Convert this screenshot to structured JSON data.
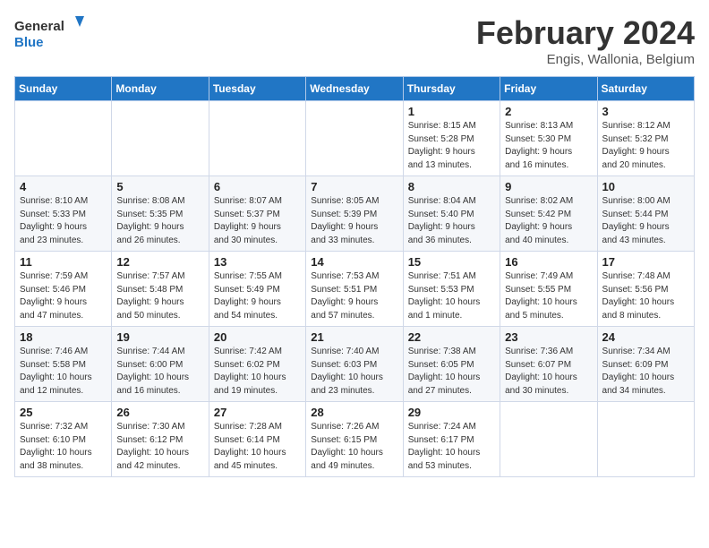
{
  "header": {
    "logo_line1": "General",
    "logo_line2": "Blue",
    "title": "February 2024",
    "location": "Engis, Wallonia, Belgium"
  },
  "weekdays": [
    "Sunday",
    "Monday",
    "Tuesday",
    "Wednesday",
    "Thursday",
    "Friday",
    "Saturday"
  ],
  "weeks": [
    [
      {
        "day": "",
        "info": ""
      },
      {
        "day": "",
        "info": ""
      },
      {
        "day": "",
        "info": ""
      },
      {
        "day": "",
        "info": ""
      },
      {
        "day": "1",
        "info": "Sunrise: 8:15 AM\nSunset: 5:28 PM\nDaylight: 9 hours\nand 13 minutes."
      },
      {
        "day": "2",
        "info": "Sunrise: 8:13 AM\nSunset: 5:30 PM\nDaylight: 9 hours\nand 16 minutes."
      },
      {
        "day": "3",
        "info": "Sunrise: 8:12 AM\nSunset: 5:32 PM\nDaylight: 9 hours\nand 20 minutes."
      }
    ],
    [
      {
        "day": "4",
        "info": "Sunrise: 8:10 AM\nSunset: 5:33 PM\nDaylight: 9 hours\nand 23 minutes."
      },
      {
        "day": "5",
        "info": "Sunrise: 8:08 AM\nSunset: 5:35 PM\nDaylight: 9 hours\nand 26 minutes."
      },
      {
        "day": "6",
        "info": "Sunrise: 8:07 AM\nSunset: 5:37 PM\nDaylight: 9 hours\nand 30 minutes."
      },
      {
        "day": "7",
        "info": "Sunrise: 8:05 AM\nSunset: 5:39 PM\nDaylight: 9 hours\nand 33 minutes."
      },
      {
        "day": "8",
        "info": "Sunrise: 8:04 AM\nSunset: 5:40 PM\nDaylight: 9 hours\nand 36 minutes."
      },
      {
        "day": "9",
        "info": "Sunrise: 8:02 AM\nSunset: 5:42 PM\nDaylight: 9 hours\nand 40 minutes."
      },
      {
        "day": "10",
        "info": "Sunrise: 8:00 AM\nSunset: 5:44 PM\nDaylight: 9 hours\nand 43 minutes."
      }
    ],
    [
      {
        "day": "11",
        "info": "Sunrise: 7:59 AM\nSunset: 5:46 PM\nDaylight: 9 hours\nand 47 minutes."
      },
      {
        "day": "12",
        "info": "Sunrise: 7:57 AM\nSunset: 5:48 PM\nDaylight: 9 hours\nand 50 minutes."
      },
      {
        "day": "13",
        "info": "Sunrise: 7:55 AM\nSunset: 5:49 PM\nDaylight: 9 hours\nand 54 minutes."
      },
      {
        "day": "14",
        "info": "Sunrise: 7:53 AM\nSunset: 5:51 PM\nDaylight: 9 hours\nand 57 minutes."
      },
      {
        "day": "15",
        "info": "Sunrise: 7:51 AM\nSunset: 5:53 PM\nDaylight: 10 hours\nand 1 minute."
      },
      {
        "day": "16",
        "info": "Sunrise: 7:49 AM\nSunset: 5:55 PM\nDaylight: 10 hours\nand 5 minutes."
      },
      {
        "day": "17",
        "info": "Sunrise: 7:48 AM\nSunset: 5:56 PM\nDaylight: 10 hours\nand 8 minutes."
      }
    ],
    [
      {
        "day": "18",
        "info": "Sunrise: 7:46 AM\nSunset: 5:58 PM\nDaylight: 10 hours\nand 12 minutes."
      },
      {
        "day": "19",
        "info": "Sunrise: 7:44 AM\nSunset: 6:00 PM\nDaylight: 10 hours\nand 16 minutes."
      },
      {
        "day": "20",
        "info": "Sunrise: 7:42 AM\nSunset: 6:02 PM\nDaylight: 10 hours\nand 19 minutes."
      },
      {
        "day": "21",
        "info": "Sunrise: 7:40 AM\nSunset: 6:03 PM\nDaylight: 10 hours\nand 23 minutes."
      },
      {
        "day": "22",
        "info": "Sunrise: 7:38 AM\nSunset: 6:05 PM\nDaylight: 10 hours\nand 27 minutes."
      },
      {
        "day": "23",
        "info": "Sunrise: 7:36 AM\nSunset: 6:07 PM\nDaylight: 10 hours\nand 30 minutes."
      },
      {
        "day": "24",
        "info": "Sunrise: 7:34 AM\nSunset: 6:09 PM\nDaylight: 10 hours\nand 34 minutes."
      }
    ],
    [
      {
        "day": "25",
        "info": "Sunrise: 7:32 AM\nSunset: 6:10 PM\nDaylight: 10 hours\nand 38 minutes."
      },
      {
        "day": "26",
        "info": "Sunrise: 7:30 AM\nSunset: 6:12 PM\nDaylight: 10 hours\nand 42 minutes."
      },
      {
        "day": "27",
        "info": "Sunrise: 7:28 AM\nSunset: 6:14 PM\nDaylight: 10 hours\nand 45 minutes."
      },
      {
        "day": "28",
        "info": "Sunrise: 7:26 AM\nSunset: 6:15 PM\nDaylight: 10 hours\nand 49 minutes."
      },
      {
        "day": "29",
        "info": "Sunrise: 7:24 AM\nSunset: 6:17 PM\nDaylight: 10 hours\nand 53 minutes."
      },
      {
        "day": "",
        "info": ""
      },
      {
        "day": "",
        "info": ""
      }
    ]
  ]
}
